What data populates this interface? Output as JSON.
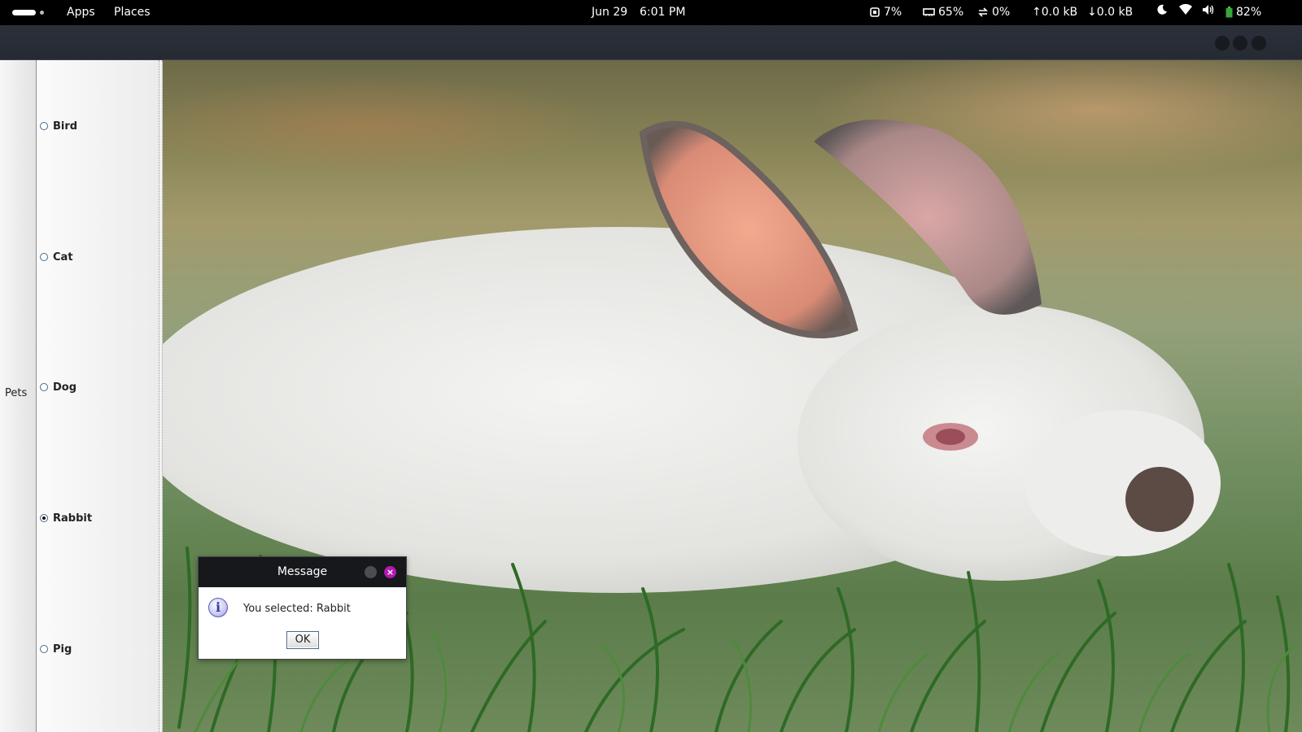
{
  "topbar": {
    "apps_label": "Apps",
    "places_label": "Places",
    "date": "Jun 29",
    "time": "6:01 PM",
    "cpu": "7%",
    "memory": "65%",
    "swap": "0%",
    "upload": "0.0 kB",
    "download": "0.0 kB",
    "battery": "82%"
  },
  "panel": {
    "group_label": "Pets",
    "options": [
      {
        "label": "Bird",
        "checked": false
      },
      {
        "label": "Cat",
        "checked": false
      },
      {
        "label": "Dog",
        "checked": false
      },
      {
        "label": "Rabbit",
        "checked": true
      },
      {
        "label": "Pig",
        "checked": false
      }
    ]
  },
  "dialog": {
    "title": "Message",
    "message": "You selected: Rabbit",
    "ok_label": "OK",
    "icon_glyph": "i"
  },
  "colors": {
    "accent_close": "#b01bb0",
    "window_titlebar": "#2b303a"
  }
}
